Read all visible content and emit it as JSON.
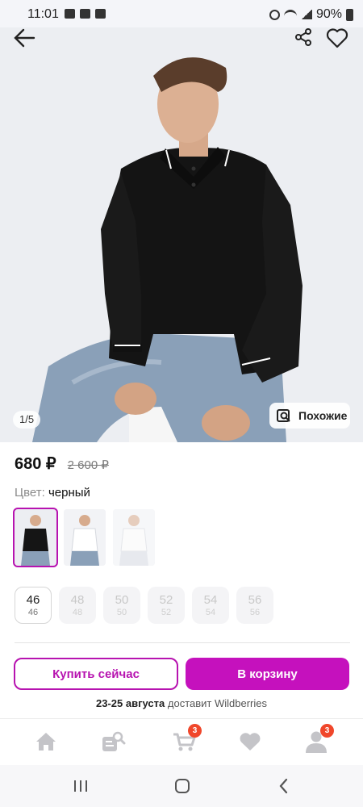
{
  "status_bar": {
    "time": "11:01",
    "battery": "90%"
  },
  "product": {
    "image_counter": "1/5",
    "similar_label": "Похожие",
    "price": "680 ₽",
    "old_price": "2 600 ₽",
    "color_label": "Цвет:",
    "color_value": "черный",
    "sizes": [
      {
        "main": "46",
        "sub": "46",
        "available": true
      },
      {
        "main": "48",
        "sub": "48",
        "available": false
      },
      {
        "main": "50",
        "sub": "50",
        "available": false
      },
      {
        "main": "52",
        "sub": "52",
        "available": false
      },
      {
        "main": "54",
        "sub": "54",
        "available": false
      },
      {
        "main": "56",
        "sub": "56",
        "available": false
      }
    ]
  },
  "actions": {
    "buy_now": "Купить сейчас",
    "add_to_cart": "В корзину",
    "delivery_dates": "23-25 августа",
    "delivery_text": "доставит Wildberries"
  },
  "bottom_nav": {
    "cart_badge": "3",
    "profile_badge": "3"
  },
  "colors": {
    "accent": "#c511bd",
    "badge": "#f0472b"
  }
}
